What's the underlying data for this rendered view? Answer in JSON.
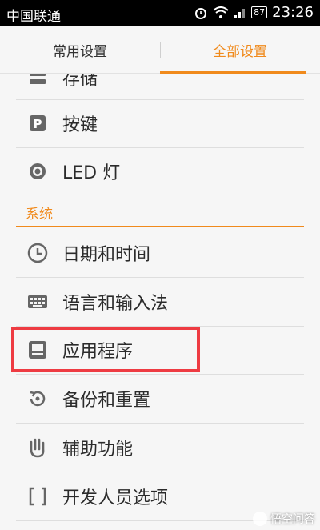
{
  "status_bar": {
    "carrier": "中国联通",
    "battery": "87",
    "time": "23:26"
  },
  "tabs": {
    "common": "常用设置",
    "all": "全部设置"
  },
  "items_top": [
    {
      "label": "存储",
      "icon": "storage-icon"
    },
    {
      "label": "按键",
      "icon": "key-icon"
    },
    {
      "label": "LED 灯",
      "icon": "led-icon"
    }
  ],
  "section": {
    "title": "系统"
  },
  "items_system": [
    {
      "label": "日期和时间",
      "icon": "clock-icon"
    },
    {
      "label": "语言和输入法",
      "icon": "keyboard-icon"
    },
    {
      "label": "应用程序",
      "icon": "apps-icon"
    },
    {
      "label": "备份和重置",
      "icon": "backup-icon"
    },
    {
      "label": "辅助功能",
      "icon": "hand-icon"
    },
    {
      "label": "开发人员选项",
      "icon": "bracket-icon"
    }
  ],
  "colors": {
    "accent": "#f08a1c",
    "highlight": "#ee3b42"
  },
  "watermark": "悟空问答"
}
